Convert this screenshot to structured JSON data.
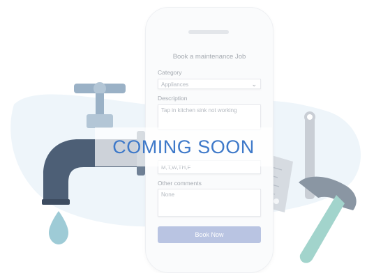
{
  "form": {
    "title": "Book a maintenance Job",
    "category_label": "Category",
    "category_value": "Appliances",
    "description_label": "Description",
    "description_value": "Tap in kitchen sink not working",
    "days_value": "M,T,W,TH,F",
    "comments_label": "Other comments",
    "comments_value": "None",
    "submit_label": "Book Now"
  },
  "overlay": {
    "text": "COMING SOON"
  },
  "colors": {
    "accent": "#3e79c9",
    "button": "#b9c4e2",
    "faucet": "#4d5f76",
    "water": "#9ecbd6"
  }
}
